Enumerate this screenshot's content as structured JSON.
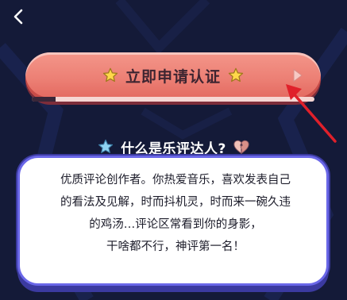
{
  "nav": {
    "back_icon": "chevron-left-icon"
  },
  "apply": {
    "label": "立即申请认证",
    "icon_left": "star-icon",
    "icon_right": "star-icon",
    "arrow_icon": "play-triangle-icon"
  },
  "section": {
    "title": "什么是乐评达人?",
    "icon_left": "star-icon",
    "icon_right": "broken-heart-icon"
  },
  "description": {
    "lines": [
      "优质评论创作者。你热爱音乐，喜欢发表自己",
      "的看法及见解，时而抖机灵，时而来一碗久违",
      "的鸡汤…评论区常看到你的身影，",
      "干啥都不行，神评第一名！"
    ]
  },
  "colors": {
    "background": "#141a38",
    "button": "#ec7f74",
    "card_border": "#6a67e8",
    "annotation_arrow": "#e0202a"
  }
}
